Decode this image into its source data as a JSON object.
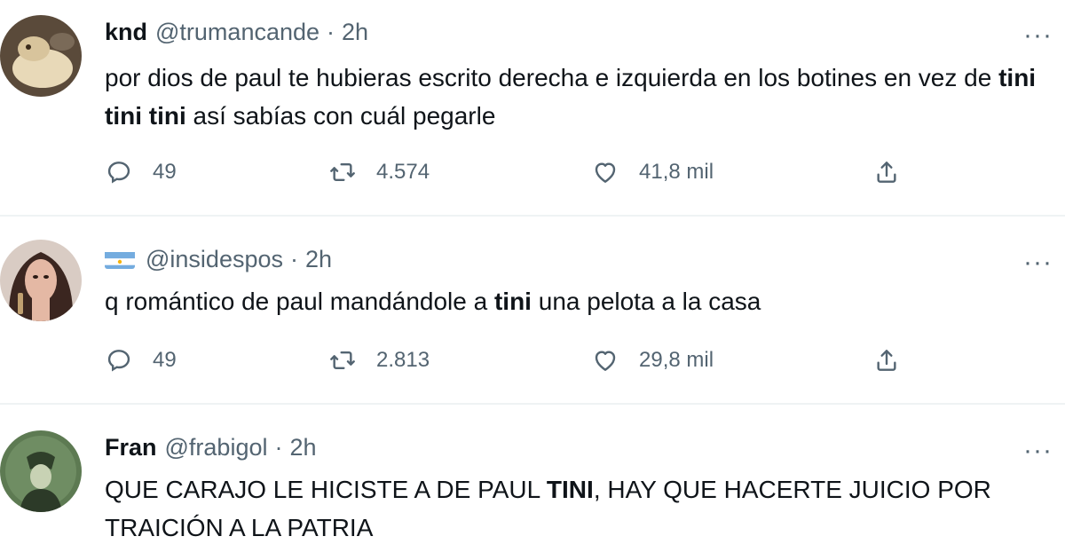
{
  "tweets": [
    {
      "name": "knd",
      "handle": "@trumancande",
      "separator": "·",
      "time": "2h",
      "text_parts": [
        {
          "t": "por dios de paul te hubieras escrito derecha e izquierda en los botines en vez de ",
          "bold": false
        },
        {
          "t": "tini tini tini",
          "bold": true
        },
        {
          "t": " así sabías con cuál pegarle",
          "bold": false
        }
      ],
      "replies": "49",
      "retweets": "4.574",
      "likes": "41,8 mil",
      "more": "···"
    },
    {
      "name": "",
      "handle": "@insidespos",
      "separator": "·",
      "time": "2h",
      "text_parts": [
        {
          "t": "q romántico de paul mandándole a ",
          "bold": false
        },
        {
          "t": "tini",
          "bold": true
        },
        {
          "t": " una pelota a la casa",
          "bold": false
        }
      ],
      "replies": "49",
      "retweets": "2.813",
      "likes": "29,8 mil",
      "more": "···"
    },
    {
      "name": "Fran",
      "handle": "@frabigol",
      "separator": "·",
      "time": "2h",
      "text_parts": [
        {
          "t": "QUE CARAJO LE HICISTE A DE PAUL ",
          "bold": false
        },
        {
          "t": "TINI",
          "bold": true
        },
        {
          "t": ", HAY QUE HACERTE JUICIO POR TRAICIÓN A LA PATRIA",
          "bold": false
        }
      ],
      "more": "···"
    }
  ],
  "colors": {
    "text": "#0f1419",
    "secondary": "#536471",
    "divider": "#eff3f4",
    "flag_blue": "#74acdf"
  }
}
